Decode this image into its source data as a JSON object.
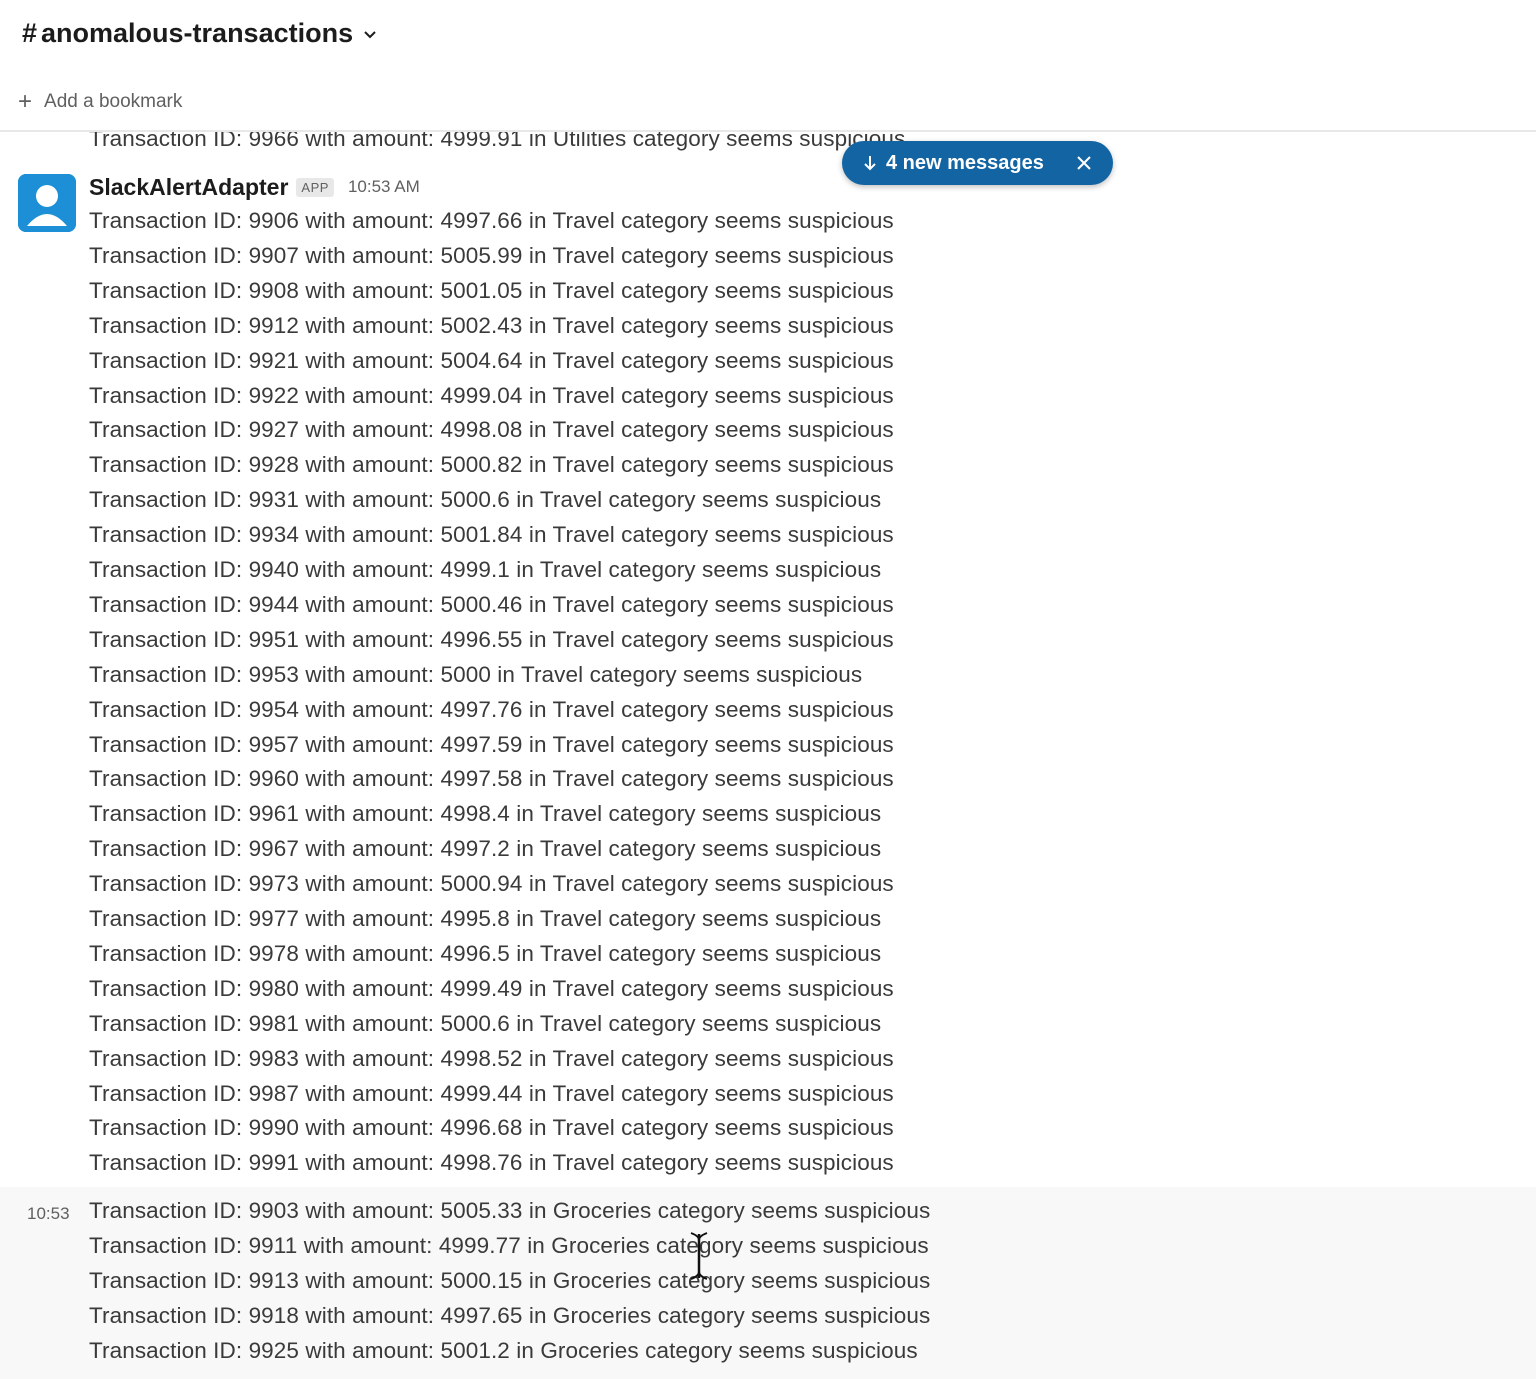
{
  "channel": {
    "hash": "#",
    "name": "anomalous-transactions",
    "bookmark_label": "Add a bookmark"
  },
  "partial_top_message": "Transaction ID: 9966 with amount: 4999.91 in Utilities category seems suspicious",
  "sender": {
    "name": "SlackAlertAdapter",
    "badge": "APP",
    "time": "10:53 AM"
  },
  "travel_messages": [
    "Transaction ID: 9906 with amount: 4997.66 in Travel category seems suspicious",
    "Transaction ID: 9907 with amount: 5005.99 in Travel category seems suspicious",
    "Transaction ID: 9908 with amount: 5001.05 in Travel category seems suspicious",
    "Transaction ID: 9912 with amount: 5002.43 in Travel category seems suspicious",
    "Transaction ID: 9921 with amount: 5004.64 in Travel category seems suspicious",
    "Transaction ID: 9922 with amount: 4999.04 in Travel category seems suspicious",
    "Transaction ID: 9927 with amount: 4998.08 in Travel category seems suspicious",
    "Transaction ID: 9928 with amount: 5000.82 in Travel category seems suspicious",
    "Transaction ID: 9931 with amount: 5000.6 in Travel category seems suspicious",
    "Transaction ID: 9934 with amount: 5001.84 in Travel category seems suspicious",
    "Transaction ID: 9940 with amount: 4999.1 in Travel category seems suspicious",
    "Transaction ID: 9944 with amount: 5000.46 in Travel category seems suspicious",
    "Transaction ID: 9951 with amount: 4996.55 in Travel category seems suspicious",
    "Transaction ID: 9953 with amount: 5000 in Travel category seems suspicious",
    "Transaction ID: 9954 with amount: 4997.76 in Travel category seems suspicious",
    "Transaction ID: 9957 with amount: 4997.59 in Travel category seems suspicious",
    "Transaction ID: 9960 with amount: 4997.58 in Travel category seems suspicious",
    "Transaction ID: 9961 with amount: 4998.4 in Travel category seems suspicious",
    "Transaction ID: 9967 with amount: 4997.2 in Travel category seems suspicious",
    "Transaction ID: 9973 with amount: 5000.94 in Travel category seems suspicious",
    "Transaction ID: 9977 with amount: 4995.8 in Travel category seems suspicious",
    "Transaction ID: 9978 with amount: 4996.5 in Travel category seems suspicious",
    "Transaction ID: 9980 with amount: 4999.49 in Travel category seems suspicious",
    "Transaction ID: 9981 with amount: 5000.6 in Travel category seems suspicious",
    "Transaction ID: 9983 with amount: 4998.52 in Travel category seems suspicious",
    "Transaction ID: 9987 with amount: 4999.44 in Travel category seems suspicious",
    "Transaction ID: 9990 with amount: 4996.68 in Travel category seems suspicious",
    "Transaction ID: 9991 with amount: 4998.76 in Travel category seems suspicious"
  ],
  "groceries_time": "10:53",
  "groceries_messages": [
    "Transaction ID: 9903 with amount: 5005.33 in Groceries category seems suspicious",
    "Transaction ID: 9911 with amount: 4999.77 in Groceries category seems suspicious",
    "Transaction ID: 9913 with amount: 5000.15 in Groceries category seems suspicious",
    "Transaction ID: 9918 with amount: 4997.65 in Groceries category seems suspicious",
    "Transaction ID: 9925 with amount: 5001.2 in Groceries category seems suspicious"
  ],
  "new_messages_pill": {
    "label": "4 new messages",
    "accent": "#1264a3"
  },
  "icons": [
    "chevron-down-icon",
    "plus-icon",
    "avatar-icon",
    "arrow-down-icon",
    "close-icon",
    "text-cursor-icon"
  ]
}
